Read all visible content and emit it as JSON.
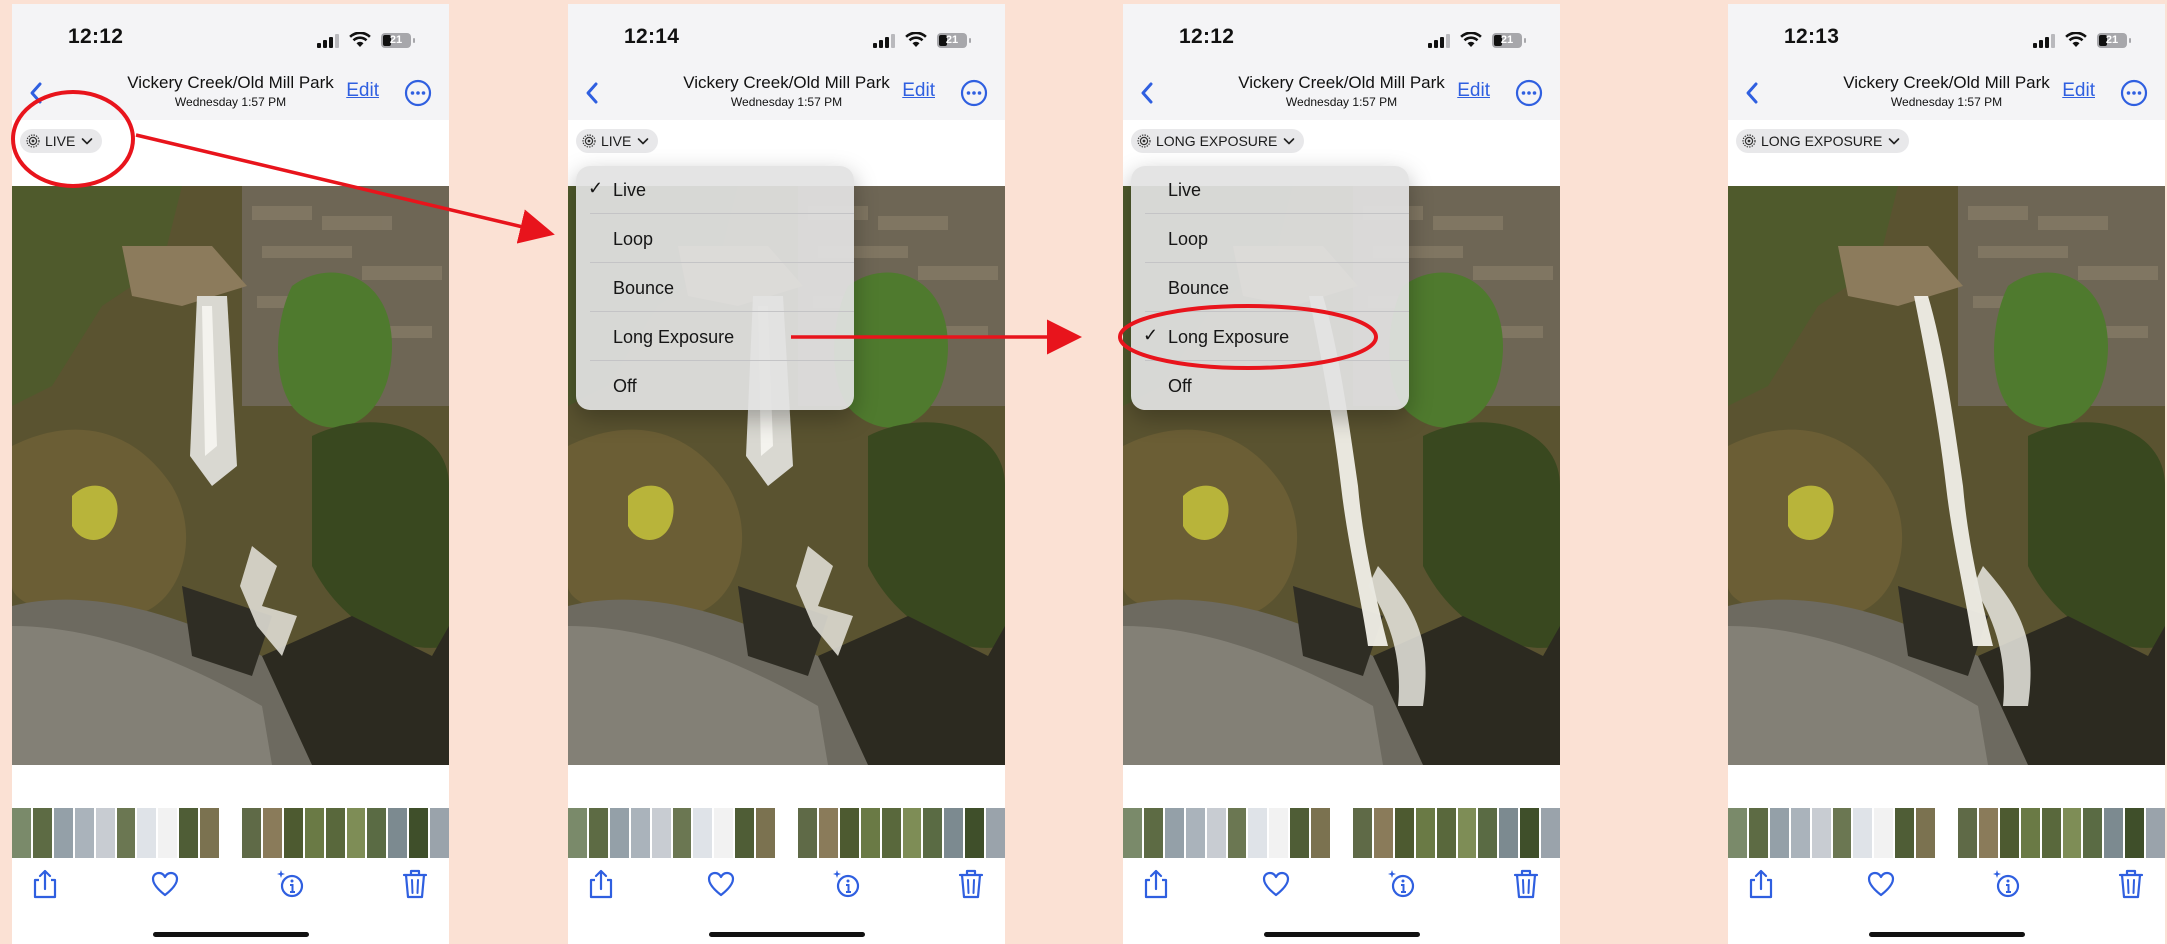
{
  "panels": [
    {
      "time": "12:12",
      "battery": "21",
      "album_title": "Vickery Creek/Old Mill Park",
      "subtitle": "Wednesday  1:57 PM",
      "edit_label": "Edit",
      "mode_label": "LIVE"
    },
    {
      "time": "12:14",
      "battery": "21",
      "album_title": "Vickery Creek/Old Mill Park",
      "subtitle": "Wednesday  1:57 PM",
      "edit_label": "Edit",
      "mode_label": "LIVE",
      "menu": {
        "items": [
          "Live",
          "Loop",
          "Bounce",
          "Long Exposure",
          "Off"
        ],
        "checked": 0
      }
    },
    {
      "time": "12:12",
      "battery": "21",
      "album_title": "Vickery Creek/Old Mill Park",
      "subtitle": "Wednesday  1:57 PM",
      "edit_label": "Edit",
      "mode_label": "LONG EXPOSURE",
      "menu": {
        "items": [
          "Live",
          "Loop",
          "Bounce",
          "Long Exposure",
          "Off"
        ],
        "checked": 3
      }
    },
    {
      "time": "12:13",
      "battery": "21",
      "album_title": "Vickery Creek/Old Mill Park",
      "subtitle": "Wednesday  1:57 PM",
      "edit_label": "Edit",
      "mode_label": "LONG EXPOSURE"
    }
  ],
  "checkmark": "✓",
  "colors": {
    "accent": "#2f5fe0",
    "annotation": "#e8141c",
    "background": "#fbe1d4"
  },
  "icons": [
    "back-chevron-icon",
    "more-ellipsis-icon",
    "live-photo-icon",
    "chevron-down-icon",
    "share-icon",
    "heart-icon",
    "info-sparkle-icon",
    "trash-icon"
  ]
}
